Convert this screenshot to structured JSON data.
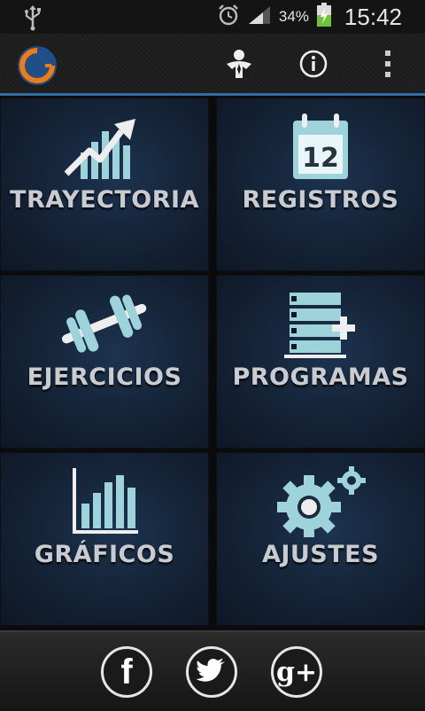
{
  "status_bar": {
    "battery_percent": "34%",
    "time": "15:42",
    "icons": [
      "usb-icon",
      "alarm-icon",
      "signal-icon",
      "battery-charging-icon"
    ]
  },
  "action_bar": {
    "logo": "app-logo",
    "actions": [
      "profile-icon",
      "info-icon",
      "overflow-menu-icon"
    ]
  },
  "tiles": [
    {
      "label": "TRAYECTORIA",
      "icon": "trend-chart-icon"
    },
    {
      "label": "REGISTROS",
      "icon": "calendar-icon",
      "calendar_day": "12"
    },
    {
      "label": "EJERCICIOS",
      "icon": "dumbbell-icon"
    },
    {
      "label": "PROGRAMAS",
      "icon": "list-add-icon"
    },
    {
      "label": "GRÁFICOS",
      "icon": "bar-chart-icon"
    },
    {
      "label": "AJUSTES",
      "icon": "gears-icon"
    }
  ],
  "social": {
    "facebook": "f",
    "twitter": "twitter-bird-icon",
    "google_plus": "g+"
  },
  "colors": {
    "accent": "#2f6fa6",
    "icon_fill": "#9fd3dc",
    "label": "#c8ccd0"
  }
}
